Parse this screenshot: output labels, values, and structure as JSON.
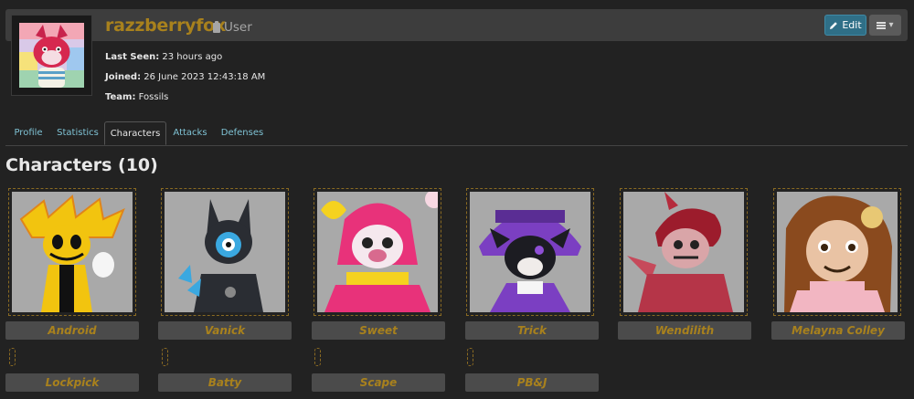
{
  "profile": {
    "username": "razzberryfox",
    "role": "User",
    "last_seen_label": "Last Seen:",
    "last_seen_value": "23 hours ago",
    "joined_label": "Joined:",
    "joined_value": "26 June 2023 12:43:18 AM",
    "team_label": "Team:",
    "team_value": "Fossils"
  },
  "actions": {
    "edit_label": "Edit",
    "edit_icon": "pencil-icon",
    "menu_icon": "hamburger-icon"
  },
  "tabs": [
    {
      "label": "Profile"
    },
    {
      "label": "Statistics"
    },
    {
      "label": "Characters",
      "active": true
    },
    {
      "label": "Attacks"
    },
    {
      "label": "Defenses"
    }
  ],
  "characters_section": {
    "title": "Characters (10)"
  },
  "characters": [
    {
      "name": "Android"
    },
    {
      "name": "Vanick"
    },
    {
      "name": "Sweet"
    },
    {
      "name": "Trick"
    },
    {
      "name": "Wendilith"
    },
    {
      "name": "Melayna Colley"
    },
    {
      "name": "Lockpick"
    },
    {
      "name": "Batty"
    },
    {
      "name": "Scape"
    },
    {
      "name": "PB&J"
    }
  ],
  "colors": {
    "accent_gold": "#a8811d",
    "edit_blue": "#2f6f87",
    "tab_link": "#7fc2d4"
  }
}
